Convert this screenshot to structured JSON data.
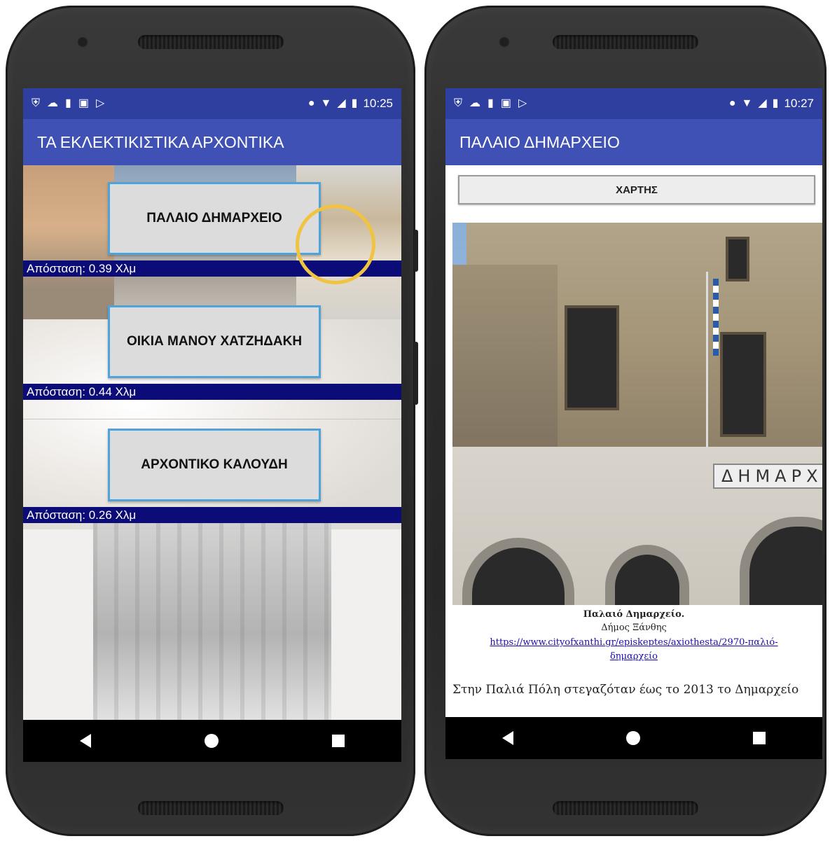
{
  "left_phone": {
    "status_bar": {
      "time": "10:25",
      "icons": [
        "shield-icon",
        "cloud-icon",
        "sd-card-icon",
        "photo-icon",
        "play-store-icon"
      ],
      "right_icons": [
        "location-icon",
        "wifi-icon",
        "signal-icon",
        "battery-icon"
      ]
    },
    "app_bar": {
      "title": "ΤΑ ΕΚΛΕΚΤΙΚΙΣΤΙΚΑ ΑΡΧΟΝΤΙΚΑ"
    },
    "places": [
      {
        "name": "ΠΑΛΑΙΟ ΔΗΜΑΡΧΕΙΟ",
        "distance": "Απόσταση: 0.39 Χλμ"
      },
      {
        "name": "ΟΙΚΙΑ ΜΑΝΟΥ ΧΑΤΖΗΔΑΚΗ",
        "distance": "Απόσταση: 0.44 Χλμ"
      },
      {
        "name": "ΑΡΧΟΝΤΙΚΟ ΚΑΛΟΥΔΗ",
        "distance": "Απόσταση: 0.26 Χλμ"
      }
    ]
  },
  "right_phone": {
    "status_bar": {
      "time": "10:27"
    },
    "app_bar": {
      "title": "ΠΑΛΑΙΟ ΔΗΜΑΡΧΕΙΟ"
    },
    "map_button": "ΧΑΡΤΗΣ",
    "photo_sign": "ΔΗΜΑΡΧ",
    "caption": {
      "title": "Παλαιό Δημαρχείο.",
      "source": "Δήμος Ξάνθης",
      "link": "https://www.cityofxanthi.gr/episkeptes/axiothesta/2970-παλιό-δημαρχείο"
    },
    "body_text": "Στην Παλιά Πόλη στεγαζόταν έως το 2013 το Δημαρχείο"
  },
  "colors": {
    "app_bar": "#3f51b5",
    "status_bar": "#2f3f9f",
    "distance_bar": "#0c0c78",
    "button_border": "#4fa3d9",
    "highlight": "#f0c341"
  }
}
